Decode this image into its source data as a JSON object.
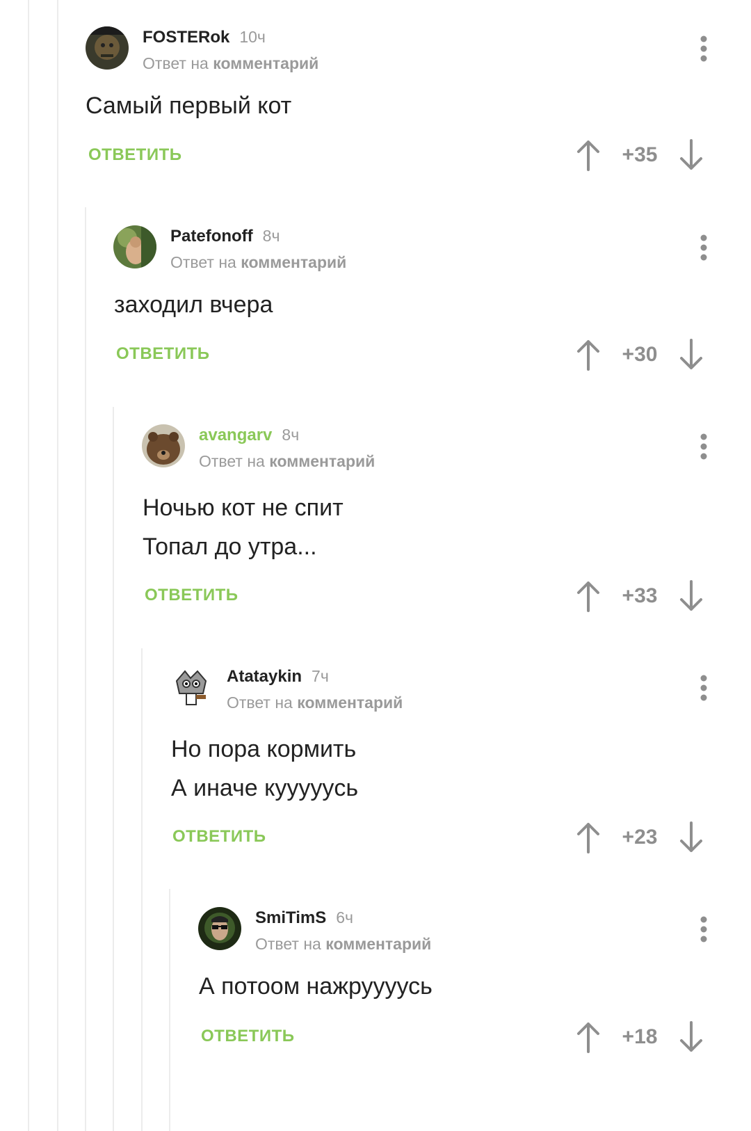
{
  "reply_label": "ОТВЕТИТЬ",
  "reply_prefix": "Ответ на",
  "reply_target": "комментарий",
  "colors": {
    "accent_green": "#8ac858",
    "muted": "#9a9a9a",
    "text": "#222222"
  },
  "comments": [
    {
      "username": "FOSTERok",
      "time": "10ч",
      "body": [
        "Самый первый кот"
      ],
      "score": "+35",
      "username_green": false
    },
    {
      "username": "Patefonoff",
      "time": "8ч",
      "body": [
        "заходил вчера"
      ],
      "score": "+30",
      "username_green": false
    },
    {
      "username": "avangarv",
      "time": "8ч",
      "body": [
        "Ночью кот не спит",
        "Топал до утра..."
      ],
      "score": "+33",
      "username_green": true
    },
    {
      "username": "Atataykin",
      "time": "7ч",
      "body": [
        "Но пора кормить",
        "А иначе куууууcь"
      ],
      "score": "+23",
      "username_green": false
    },
    {
      "username": "SmiTimS",
      "time": "6ч",
      "body": [
        "А потоом нажруууусь"
      ],
      "score": "+18",
      "username_green": false
    }
  ],
  "icons": {
    "upvote": "arrow-up-icon",
    "downvote": "arrow-down-icon",
    "more": "more-vertical-icon"
  }
}
